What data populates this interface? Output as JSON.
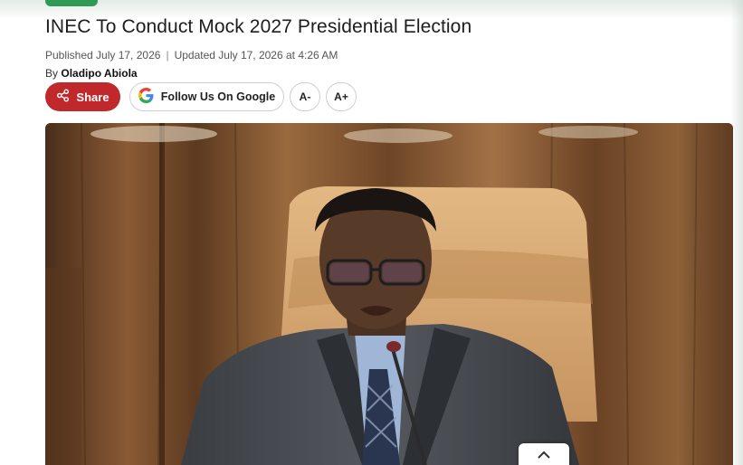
{
  "article": {
    "title": "INEC To Conduct Mock 2027 Presidential Election",
    "published": "Published July 17, 2026",
    "separator": "|",
    "updated": "Updated July 17, 2026 at 4:26 AM",
    "byline_prefix": "By",
    "author": "Oladipo Abiola"
  },
  "actions": {
    "share_label": "Share",
    "follow_label": "Follow Us On Google",
    "font_decrease": "A-",
    "font_increase": "A+"
  },
  "colors": {
    "share_bg": "#c0282b",
    "accent_green": "#2e9a55"
  },
  "icons": {
    "share": "share-icon",
    "google": "google-g-icon",
    "scroll_top": "chevron-up-icon"
  }
}
